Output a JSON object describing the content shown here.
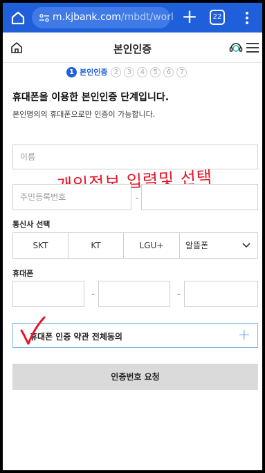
{
  "browser": {
    "url_host": "m.kjbank.com",
    "url_path": "/mbdt/worl",
    "tab_count": "22",
    "theme_color": "#1f5fd9"
  },
  "app": {
    "title": "본인인증"
  },
  "steps": {
    "current_number": "1",
    "current_label": "본인인증",
    "others": [
      "2",
      "3",
      "4",
      "5",
      "6",
      "7"
    ]
  },
  "intro": {
    "headline": "휴대폰을 이용한 본인인증 단계입니다.",
    "subtext": "본인명의의 휴대폰으로만 인증이 가능합니다."
  },
  "form": {
    "name_placeholder": "이름",
    "resident_placeholder": "주민등록번호",
    "resident_separator": "-",
    "carrier_label": "통신사 선택",
    "carriers": [
      "SKT",
      "KT",
      "LGU+"
    ],
    "carrier_select_value": "알뜰폰",
    "phone_label": "휴대폰",
    "phone_separator": "-"
  },
  "annotation": {
    "handwritten_text": "개인정보 입력및 선택",
    "color": "#e6152a"
  },
  "agreement": {
    "label": "휴대폰 인증 약관 전체동의",
    "expand_symbol": "+"
  },
  "actions": {
    "request_label": "인증번호 요청"
  }
}
